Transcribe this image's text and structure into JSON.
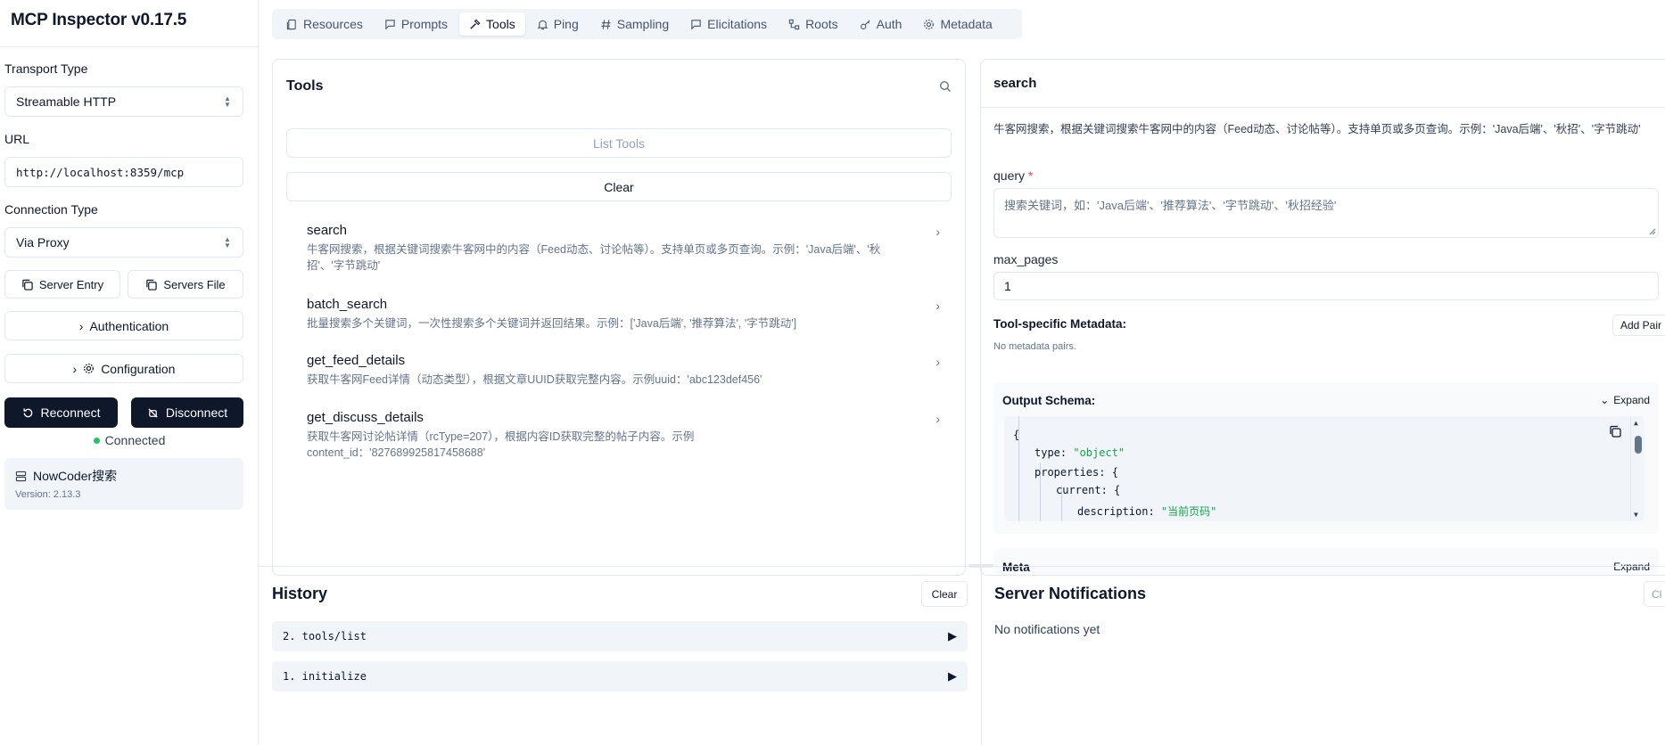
{
  "app": {
    "title": "MCP Inspector v0.17.5"
  },
  "sidebar": {
    "transport_label": "Transport Type",
    "transport_value": "Streamable HTTP",
    "url_label": "URL",
    "url_value": "http://localhost:8359/mcp",
    "connection_label": "Connection Type",
    "connection_value": "Via Proxy",
    "server_entry": "Server Entry",
    "servers_file": "Servers File",
    "authentication": "Authentication",
    "configuration": "Configuration",
    "reconnect": "Reconnect",
    "disconnect": "Disconnect",
    "status": "Connected",
    "status_color": "#22c55e",
    "server_name": "NowCoder搜索",
    "server_version": "Version: 2.13.3"
  },
  "tabs": [
    {
      "label": "Resources",
      "icon": "resources-icon"
    },
    {
      "label": "Prompts",
      "icon": "prompts-icon"
    },
    {
      "label": "Tools",
      "icon": "tools-icon",
      "active": true
    },
    {
      "label": "Ping",
      "icon": "bell-icon"
    },
    {
      "label": "Sampling",
      "icon": "hash-icon"
    },
    {
      "label": "Elicitations",
      "icon": "chat-icon"
    },
    {
      "label": "Roots",
      "icon": "roots-icon"
    },
    {
      "label": "Auth",
      "icon": "key-icon"
    },
    {
      "label": "Metadata",
      "icon": "gear-icon"
    }
  ],
  "tools": {
    "title": "Tools",
    "list_button": "List Tools",
    "clear_button": "Clear",
    "items": [
      {
        "name": "search",
        "description": "牛客网搜索，根据关键词搜索牛客网中的内容（Feed动态、讨论帖等）。支持单页或多页查询。示例：'Java后端'、'秋招'、'字节跳动'"
      },
      {
        "name": "batch_search",
        "description": "批量搜索多个关键词，一次性搜索多个关键词并返回结果。示例：['Java后端', '推荐算法', '字节跳动']"
      },
      {
        "name": "get_feed_details",
        "description": "获取牛客网Feed详情（动态类型），根据文章UUID获取完整内容。示例uuid：'abc123def456'"
      },
      {
        "name": "get_discuss_details",
        "description": "获取牛客网讨论帖详情（rcType=207），根据内容ID获取完整的帖子内容。示例content_id：'827689925817458688'"
      }
    ]
  },
  "detail": {
    "title": "search",
    "description": "牛客网搜索，根据关键词搜索牛客网中的内容（Feed动态、讨论帖等）。支持单页或多页查询。示例：'Java后端'、'秋招'、'字节跳动'",
    "query_label": "query",
    "required_mark": "*",
    "query_placeholder": "搜索关键词，如：'Java后端'、'推荐算法'、'字节跳动'、'秋招经验'",
    "max_pages_label": "max_pages",
    "max_pages_value": "1",
    "metadata_label": "Tool-specific Metadata:",
    "add_pair": "Add Pair",
    "no_metadata": "No metadata pairs.",
    "output_schema_label": "Output Schema:",
    "expand": "Expand",
    "schema_lines": {
      "l1": "{",
      "l2_key": "type: ",
      "l2_val": "\"object\"",
      "l3": "properties: {",
      "l4": "current: {",
      "l5_key": "description: ",
      "l5_val": "\"当前页码\""
    },
    "cut_label": "Meta",
    "cut_right": "Expand"
  },
  "history": {
    "title": "History",
    "clear": "Clear",
    "rows": [
      "2. tools/list",
      "1. initialize"
    ]
  },
  "notifications": {
    "title": "Server Notifications",
    "empty": "No notifications yet",
    "clear": "Cl"
  }
}
